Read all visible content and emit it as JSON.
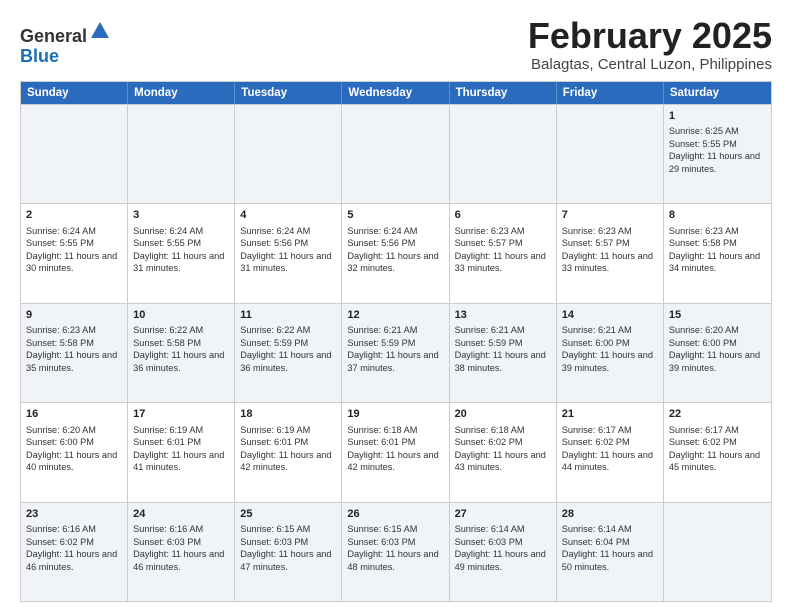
{
  "logo": {
    "general": "General",
    "blue": "Blue"
  },
  "header": {
    "month": "February 2025",
    "location": "Balagtas, Central Luzon, Philippines"
  },
  "weekdays": [
    "Sunday",
    "Monday",
    "Tuesday",
    "Wednesday",
    "Thursday",
    "Friday",
    "Saturday"
  ],
  "rows": [
    [
      {
        "day": "",
        "text": ""
      },
      {
        "day": "",
        "text": ""
      },
      {
        "day": "",
        "text": ""
      },
      {
        "day": "",
        "text": ""
      },
      {
        "day": "",
        "text": ""
      },
      {
        "day": "",
        "text": ""
      },
      {
        "day": "1",
        "text": "Sunrise: 6:25 AM\nSunset: 5:55 PM\nDaylight: 11 hours and 29 minutes."
      }
    ],
    [
      {
        "day": "2",
        "text": "Sunrise: 6:24 AM\nSunset: 5:55 PM\nDaylight: 11 hours and 30 minutes."
      },
      {
        "day": "3",
        "text": "Sunrise: 6:24 AM\nSunset: 5:55 PM\nDaylight: 11 hours and 31 minutes."
      },
      {
        "day": "4",
        "text": "Sunrise: 6:24 AM\nSunset: 5:56 PM\nDaylight: 11 hours and 31 minutes."
      },
      {
        "day": "5",
        "text": "Sunrise: 6:24 AM\nSunset: 5:56 PM\nDaylight: 11 hours and 32 minutes."
      },
      {
        "day": "6",
        "text": "Sunrise: 6:23 AM\nSunset: 5:57 PM\nDaylight: 11 hours and 33 minutes."
      },
      {
        "day": "7",
        "text": "Sunrise: 6:23 AM\nSunset: 5:57 PM\nDaylight: 11 hours and 33 minutes."
      },
      {
        "day": "8",
        "text": "Sunrise: 6:23 AM\nSunset: 5:58 PM\nDaylight: 11 hours and 34 minutes."
      }
    ],
    [
      {
        "day": "9",
        "text": "Sunrise: 6:23 AM\nSunset: 5:58 PM\nDaylight: 11 hours and 35 minutes."
      },
      {
        "day": "10",
        "text": "Sunrise: 6:22 AM\nSunset: 5:58 PM\nDaylight: 11 hours and 36 minutes."
      },
      {
        "day": "11",
        "text": "Sunrise: 6:22 AM\nSunset: 5:59 PM\nDaylight: 11 hours and 36 minutes."
      },
      {
        "day": "12",
        "text": "Sunrise: 6:21 AM\nSunset: 5:59 PM\nDaylight: 11 hours and 37 minutes."
      },
      {
        "day": "13",
        "text": "Sunrise: 6:21 AM\nSunset: 5:59 PM\nDaylight: 11 hours and 38 minutes."
      },
      {
        "day": "14",
        "text": "Sunrise: 6:21 AM\nSunset: 6:00 PM\nDaylight: 11 hours and 39 minutes."
      },
      {
        "day": "15",
        "text": "Sunrise: 6:20 AM\nSunset: 6:00 PM\nDaylight: 11 hours and 39 minutes."
      }
    ],
    [
      {
        "day": "16",
        "text": "Sunrise: 6:20 AM\nSunset: 6:00 PM\nDaylight: 11 hours and 40 minutes."
      },
      {
        "day": "17",
        "text": "Sunrise: 6:19 AM\nSunset: 6:01 PM\nDaylight: 11 hours and 41 minutes."
      },
      {
        "day": "18",
        "text": "Sunrise: 6:19 AM\nSunset: 6:01 PM\nDaylight: 11 hours and 42 minutes."
      },
      {
        "day": "19",
        "text": "Sunrise: 6:18 AM\nSunset: 6:01 PM\nDaylight: 11 hours and 42 minutes."
      },
      {
        "day": "20",
        "text": "Sunrise: 6:18 AM\nSunset: 6:02 PM\nDaylight: 11 hours and 43 minutes."
      },
      {
        "day": "21",
        "text": "Sunrise: 6:17 AM\nSunset: 6:02 PM\nDaylight: 11 hours and 44 minutes."
      },
      {
        "day": "22",
        "text": "Sunrise: 6:17 AM\nSunset: 6:02 PM\nDaylight: 11 hours and 45 minutes."
      }
    ],
    [
      {
        "day": "23",
        "text": "Sunrise: 6:16 AM\nSunset: 6:02 PM\nDaylight: 11 hours and 46 minutes."
      },
      {
        "day": "24",
        "text": "Sunrise: 6:16 AM\nSunset: 6:03 PM\nDaylight: 11 hours and 46 minutes."
      },
      {
        "day": "25",
        "text": "Sunrise: 6:15 AM\nSunset: 6:03 PM\nDaylight: 11 hours and 47 minutes."
      },
      {
        "day": "26",
        "text": "Sunrise: 6:15 AM\nSunset: 6:03 PM\nDaylight: 11 hours and 48 minutes."
      },
      {
        "day": "27",
        "text": "Sunrise: 6:14 AM\nSunset: 6:03 PM\nDaylight: 11 hours and 49 minutes."
      },
      {
        "day": "28",
        "text": "Sunrise: 6:14 AM\nSunset: 6:04 PM\nDaylight: 11 hours and 50 minutes."
      },
      {
        "day": "",
        "text": ""
      }
    ]
  ]
}
